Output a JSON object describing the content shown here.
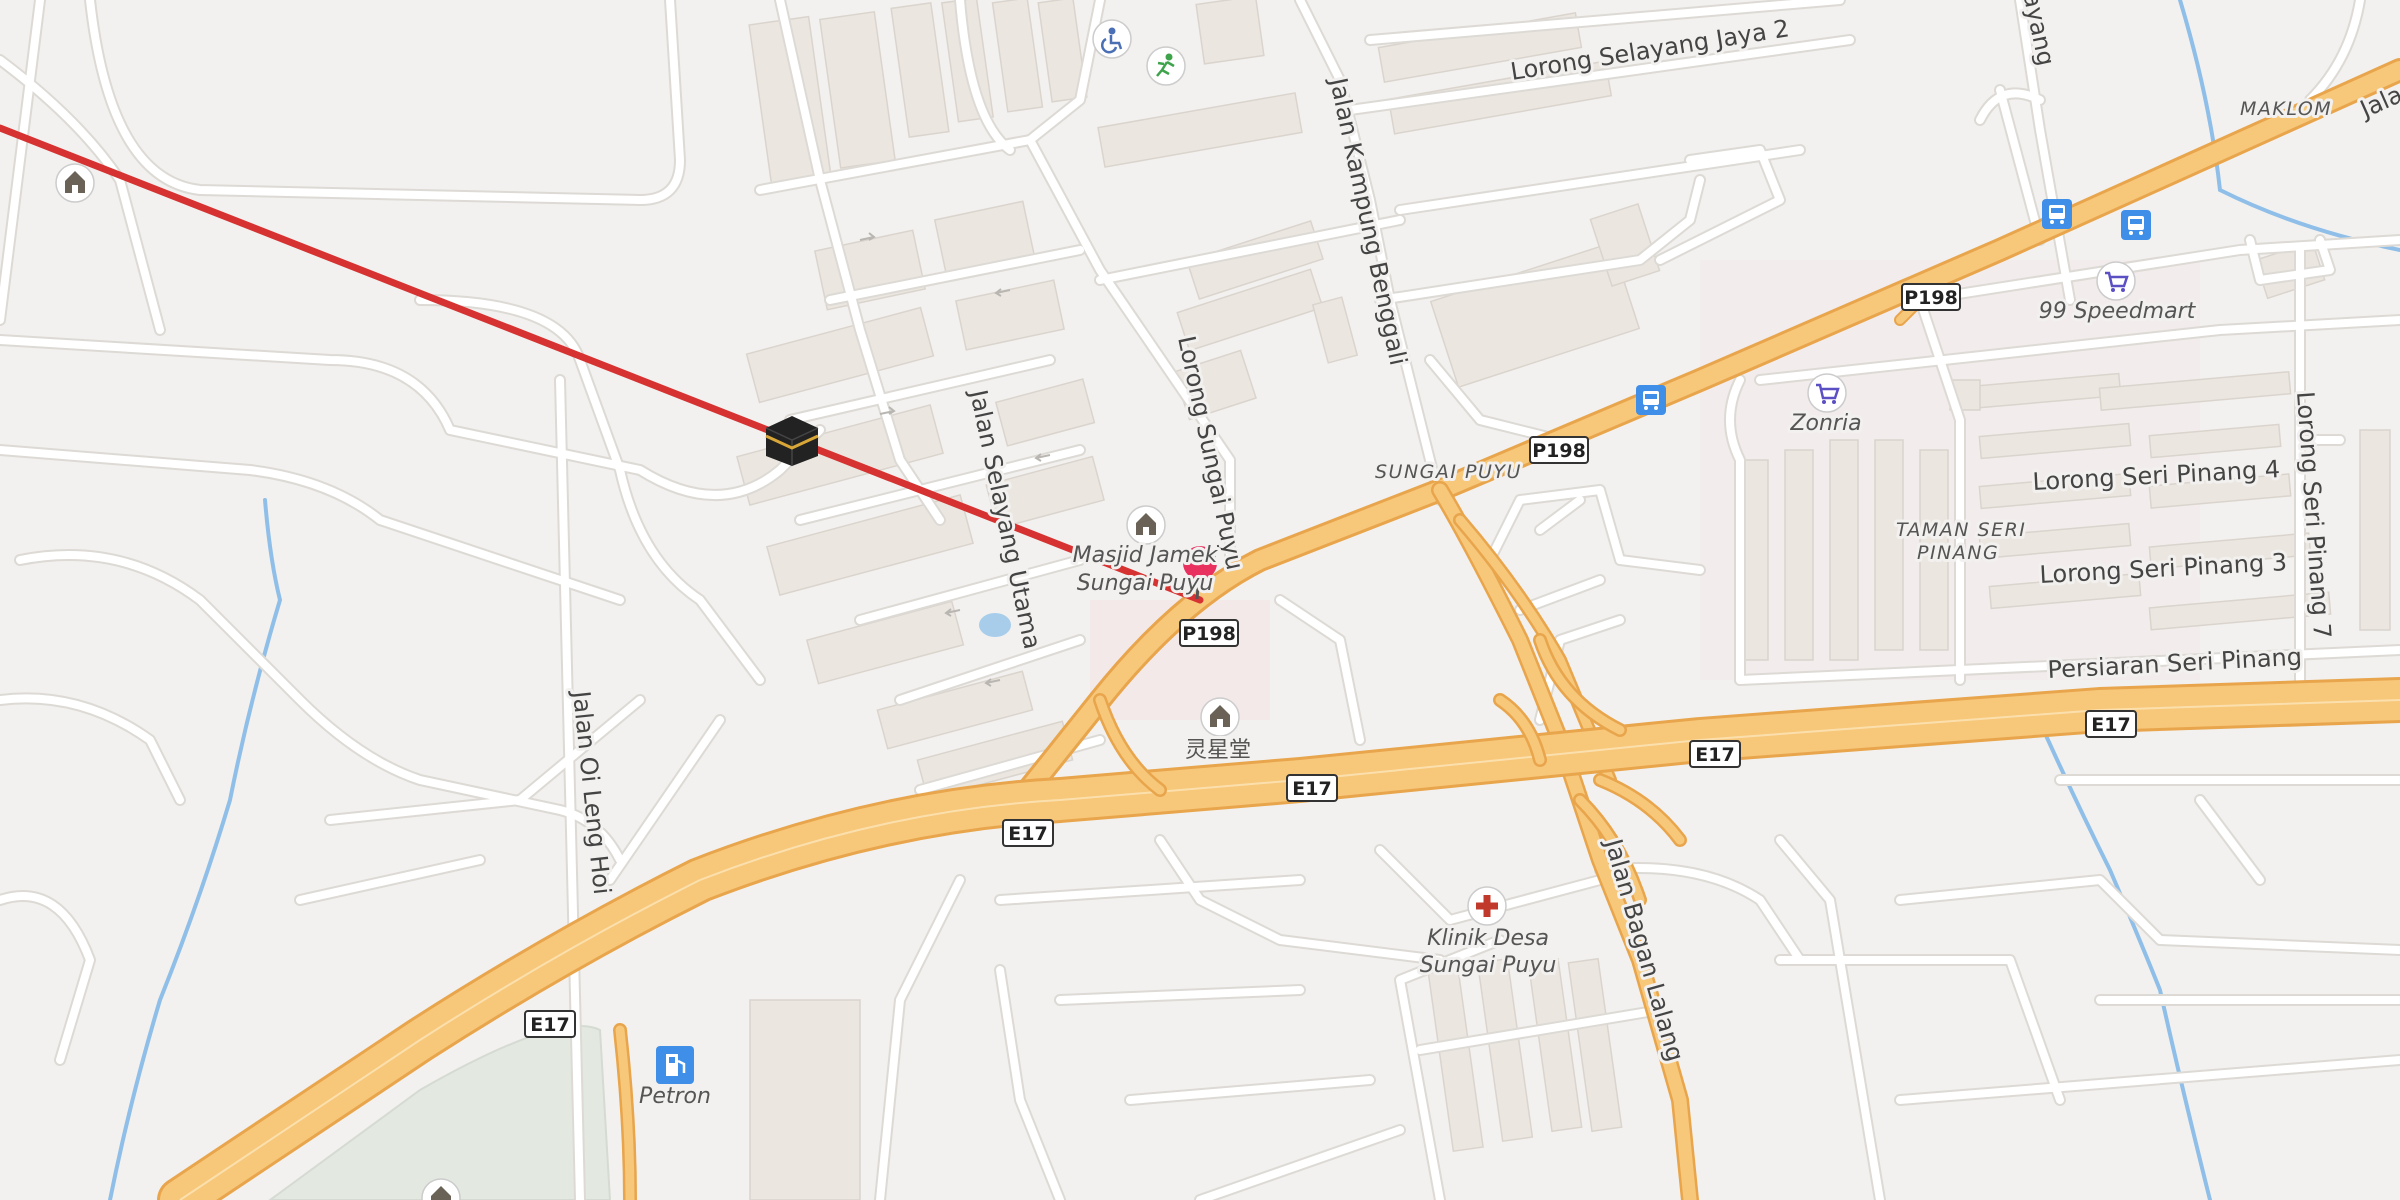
{
  "streets": {
    "lorong_selayang_jaya_2": "Lorong Selayang Jaya 2",
    "jalan_kampung_benggali": "Jalan Kampung Benggali",
    "lorong_sungai_puyu": "Lorong Sungai Puyu",
    "jalan_selayang_utama": "Jalan Selayang Utama",
    "jalan_oi_leng_hoi": "Jalan Oi Leng Hoi",
    "jalan_bagan_lalang": "Jalan Bagan Lalang",
    "lorong_seri_pinang_4": "Lorong Seri Pinang 4",
    "lorong_seri_pinang_3": "Lorong Seri Pinang 3",
    "persiaran_seri_pinang": "Persiaran Seri Pinang",
    "lorong_seri_pinang_7": "Lorong Seri Pinang 7",
    "selayang_partial": "layang",
    "jalan_partial": "Jala"
  },
  "areas": {
    "sungai_puyu": "SUNGAI PUYU",
    "taman_seri_pinang_1": "TAMAN SERI",
    "taman_seri_pinang_2": "PINANG",
    "maklom": "MAKLOM"
  },
  "pois": {
    "masjid_line1": "Masjid Jamek",
    "masjid_line2": "Sungai Puyu",
    "temple": "灵星堂",
    "klinik_line1": "Klinik Desa",
    "klinik_line2": "Sungai Puyu",
    "petron": "Petron",
    "zonria": "Zonria",
    "speedmart": "99 Speedmart"
  },
  "route_shields": {
    "p198_a": "P198",
    "p198_b": "P198",
    "p198_c": "P198",
    "e17_a": "E17",
    "e17_b": "E17",
    "e17_c": "E17",
    "e17_d": "E17"
  },
  "icons": {
    "place_of_worship": "temple-icon",
    "qibla": "kaaba-icon",
    "pin": "location-pin-icon",
    "bus": "bus-stop-icon",
    "shop": "shopping-cart-icon",
    "fuel": "fuel-station-icon",
    "clinic": "clinic-cross-icon",
    "sport": "sports-icon",
    "disability": "wheelchair-icon"
  },
  "colors": {
    "background": "#f2f1ef",
    "highway": "#f7c77a",
    "highway_casing": "#e8a54c",
    "qibla_line": "#d63232",
    "pin": "#e8315f",
    "water": "#8fbfe8",
    "bus": "#3f8fe8",
    "shop": "#5b4fc4",
    "clinic": "#c0392b"
  }
}
